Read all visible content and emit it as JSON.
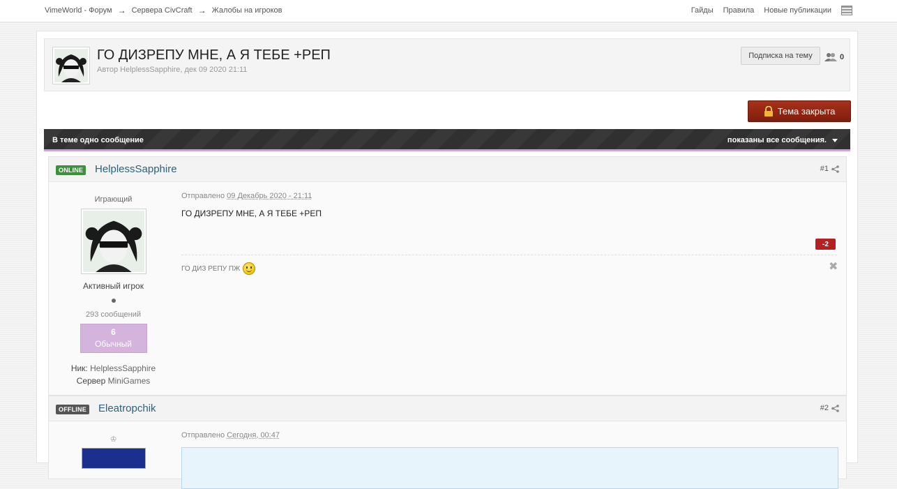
{
  "breadcrumb": {
    "items": [
      "VimeWorld - Форум",
      "Сервера CivCraft",
      "Жалобы на игроков"
    ],
    "separator": "→"
  },
  "toplinks": [
    "Гайды",
    "Правила",
    "Новые публикации"
  ],
  "topic": {
    "title": "ГО ДИЗРЕПУ МНЕ, А Я ТЕБЕ +РЕП",
    "meta": "Автор HelplessSapphire, дек 09 2020 21:11",
    "subscribe_label": "Подписка на тему",
    "followers_count": "0",
    "closed_label": "Тема закрыта"
  },
  "infobar": {
    "left": "В теме одно сообщение",
    "right": "показаны все сообщения."
  },
  "posts": [
    {
      "status": "ONLINE",
      "author": "HelplessSapphire",
      "number": "#1",
      "group": "Играющий",
      "title": "Активный игрок",
      "post_count": "293 сообщений",
      "rank_level": "6",
      "rank_name": "Обычный",
      "nick_label": "Ник:",
      "nick": "HelplessSapphire",
      "server_label": "Сервер",
      "server": "MiniGames",
      "posted_prefix": "Отправлено",
      "posted_date": "09 Декабрь 2020 - 21:11",
      "text": "ГО ДИЗРЕПУ МНЕ, А Я ТЕБЕ +РЕП",
      "reputation": "-2",
      "signature": "ГО ДИЗ РЕПУ ПЖ"
    },
    {
      "status": "OFFLINE",
      "author": "Eleatropchik",
      "number": "#2",
      "group_icon": "crown-icon",
      "posted_prefix": "Отправлено",
      "posted_date": "Сегодня, 00:47"
    }
  ],
  "colors": {
    "online": "#3f8f3f",
    "offline": "#555555",
    "closed_button": "#8f2613",
    "rank_box": "#d4b3dd",
    "author_link": "#2f5f79",
    "rep_negative": "#b52020"
  }
}
